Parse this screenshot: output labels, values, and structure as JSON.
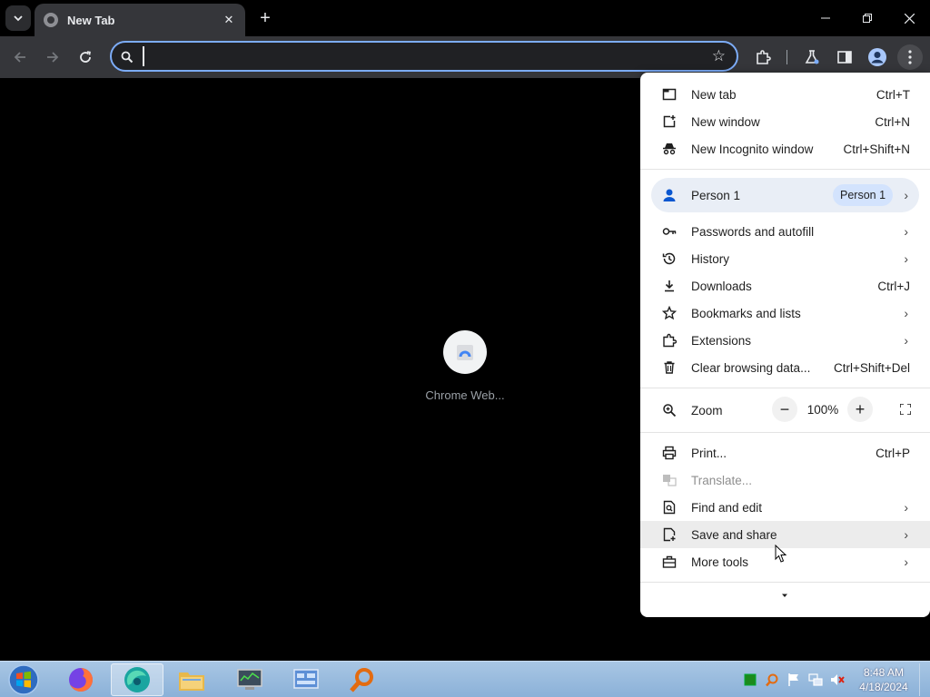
{
  "tab": {
    "title": "New Tab"
  },
  "omnibox": {
    "value": "",
    "placeholder": ""
  },
  "shortcut": {
    "label": "Chrome Web..."
  },
  "menu": {
    "new_tab": {
      "label": "New tab",
      "shortcut": "Ctrl+T"
    },
    "new_window": {
      "label": "New window",
      "shortcut": "Ctrl+N"
    },
    "incognito": {
      "label": "New Incognito window",
      "shortcut": "Ctrl+Shift+N"
    },
    "person": {
      "label": "Person 1",
      "badge": "Person 1"
    },
    "passwords": {
      "label": "Passwords and autofill"
    },
    "history": {
      "label": "History"
    },
    "downloads": {
      "label": "Downloads",
      "shortcut": "Ctrl+J"
    },
    "bookmarks": {
      "label": "Bookmarks and lists"
    },
    "extensions": {
      "label": "Extensions"
    },
    "clear_data": {
      "label": "Clear browsing data...",
      "shortcut": "Ctrl+Shift+Del"
    },
    "zoom": {
      "label": "Zoom",
      "value": "100%",
      "minus": "−",
      "plus": "+"
    },
    "print": {
      "label": "Print...",
      "shortcut": "Ctrl+P"
    },
    "translate": {
      "label": "Translate..."
    },
    "find_edit": {
      "label": "Find and edit"
    },
    "save_share": {
      "label": "Save and share"
    },
    "more_tools": {
      "label": "More tools"
    }
  },
  "taskbar": {
    "time": "8:48 AM",
    "date": "4/18/2024"
  },
  "colors": {
    "accent": "#7cacf8",
    "toolbar": "#35363a",
    "menu_bg": "#ffffff"
  }
}
